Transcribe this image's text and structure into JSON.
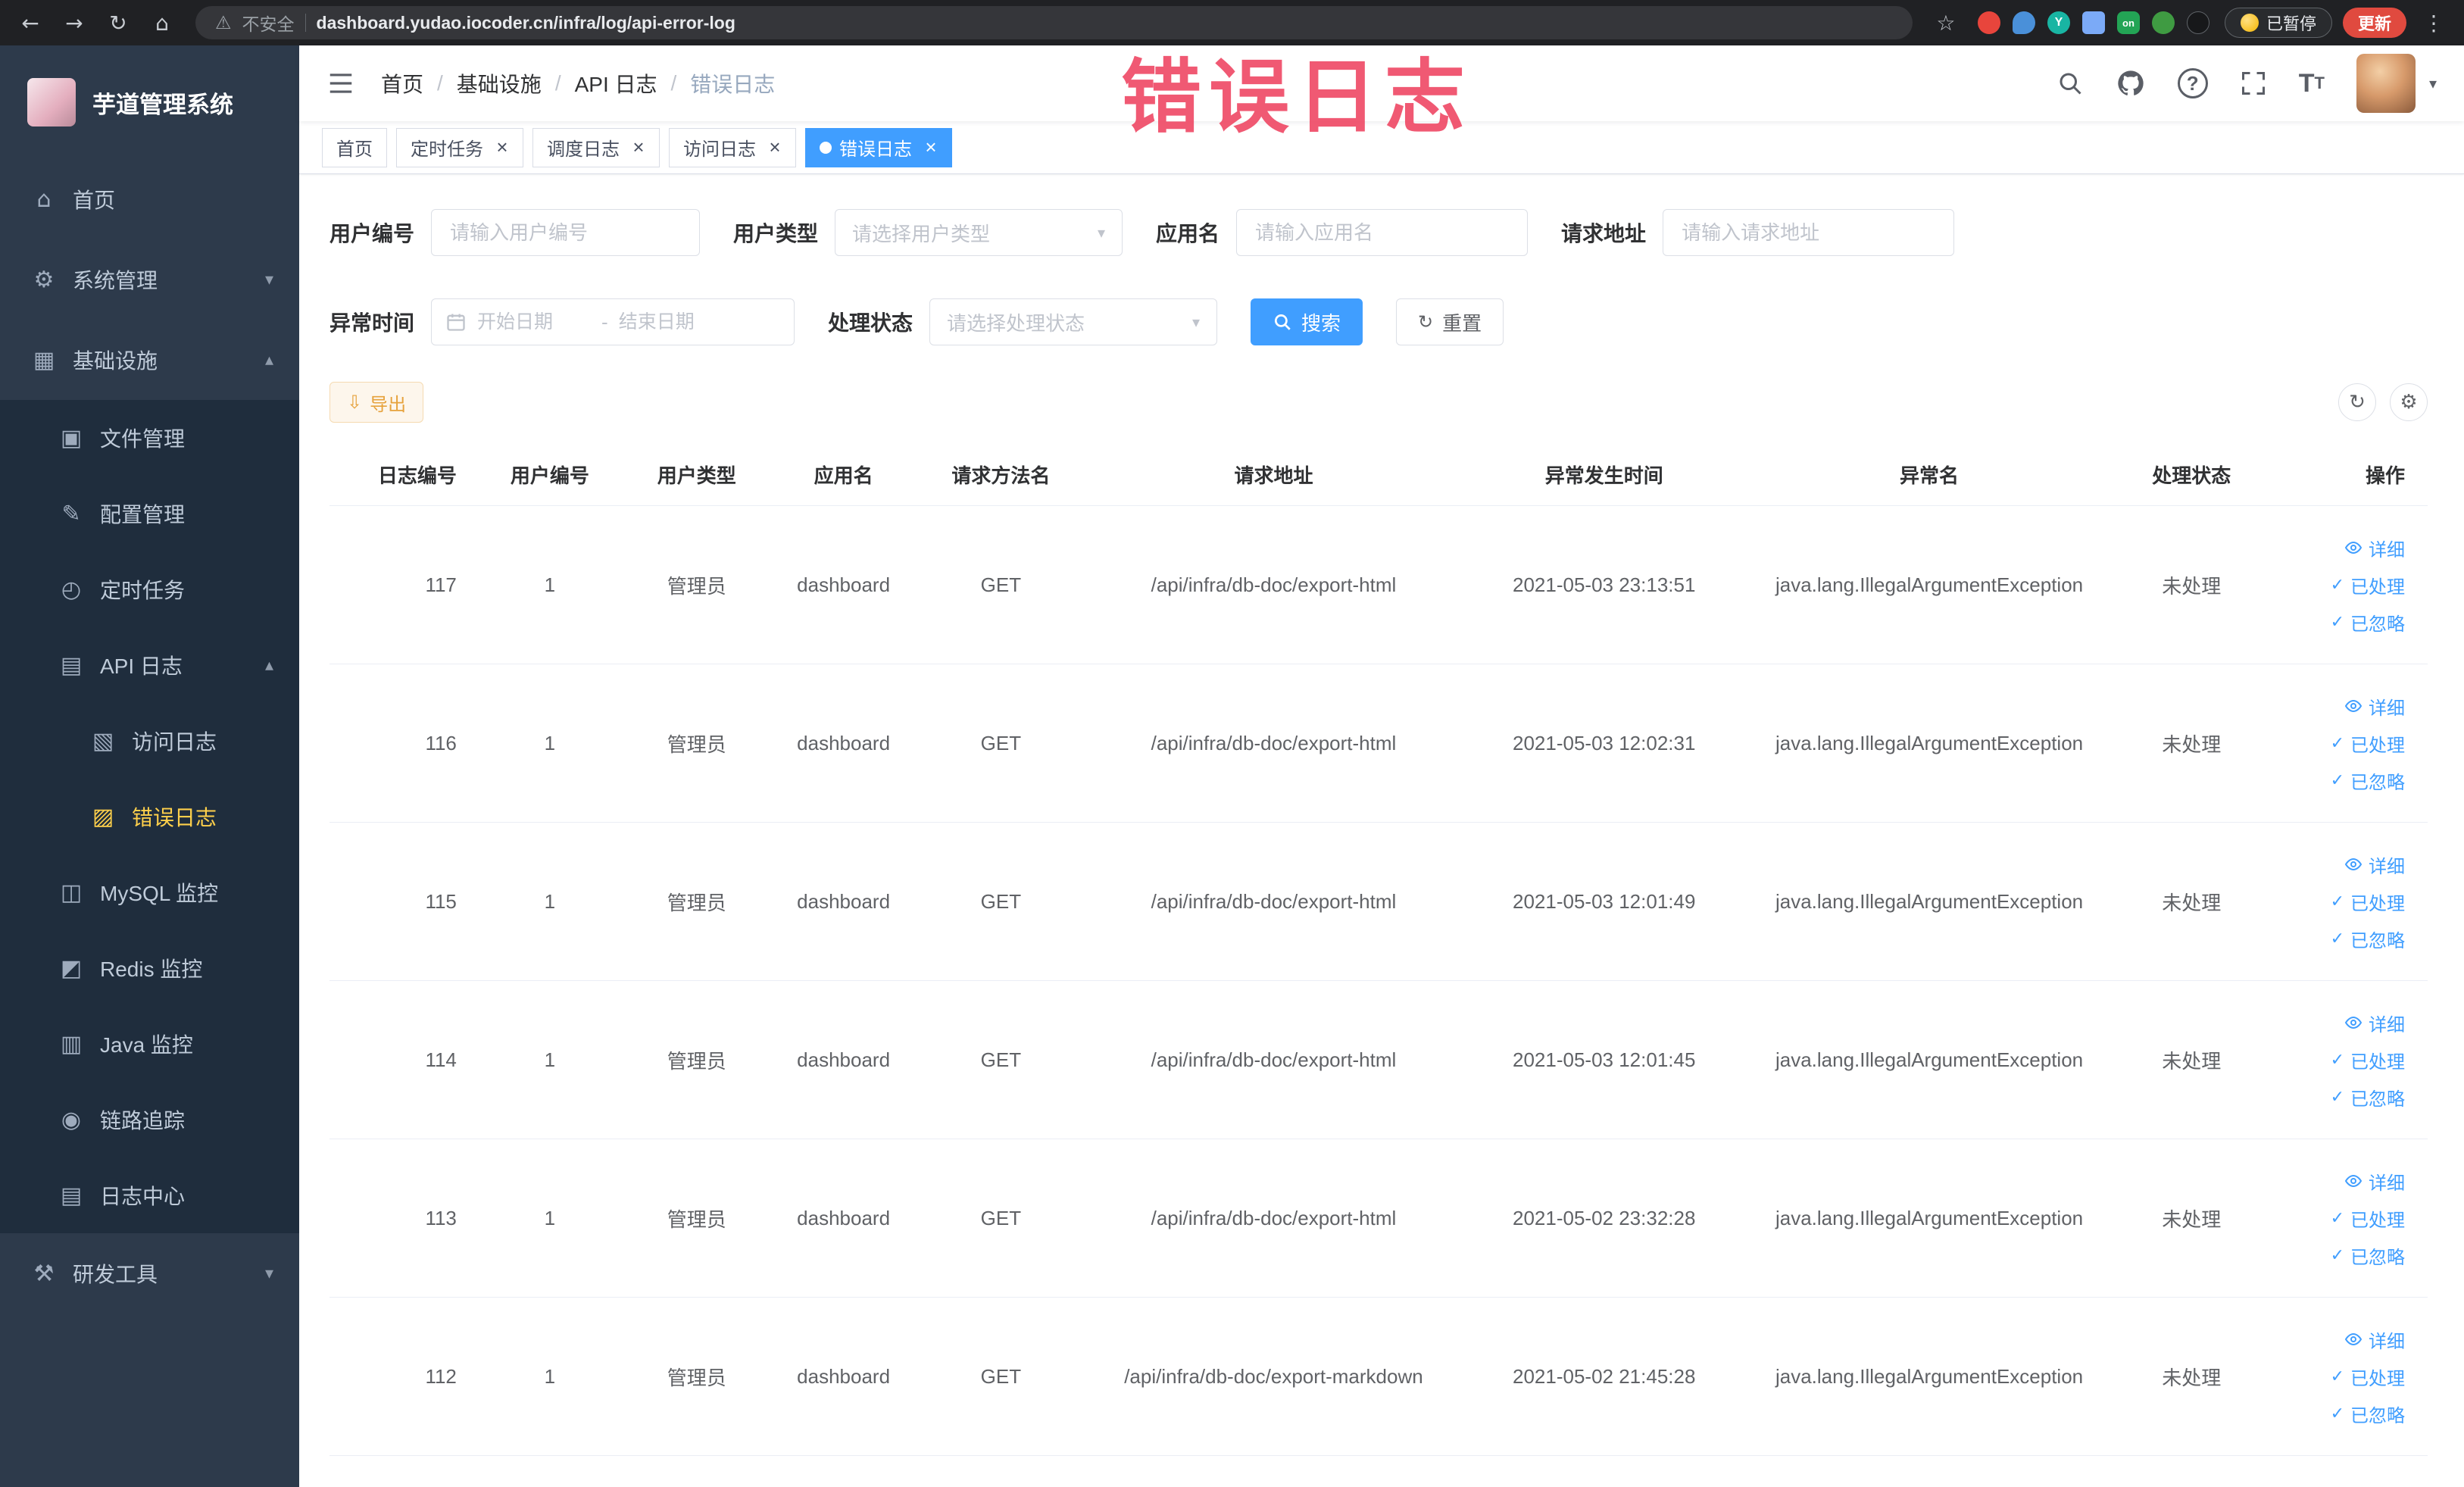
{
  "browser": {
    "security_label": "不安全",
    "url": "dashboard.yudao.iocoder.cn/infra/log/api-error-log",
    "on_badge": "on",
    "paused_button": "已暂停",
    "update_button": "更新"
  },
  "annotation": {
    "text": "错误日志"
  },
  "sidebar": {
    "logo_title": "芋道管理系统",
    "items": {
      "home": "首页",
      "system": "系统管理",
      "infra": "基础设施",
      "file": "文件管理",
      "config": "配置管理",
      "job": "定时任务",
      "api_log": "API 日志",
      "access_log": "访问日志",
      "error_log": "错误日志",
      "mysql": "MySQL 监控",
      "redis": "Redis 监控",
      "java": "Java 监控",
      "trace": "链路追踪",
      "log_center": "日志中心",
      "dev_tools": "研发工具"
    }
  },
  "header": {
    "breadcrumb": [
      "首页",
      "基础设施",
      "API 日志",
      "错误日志"
    ]
  },
  "tabs": [
    {
      "label": "首页"
    },
    {
      "label": "定时任务"
    },
    {
      "label": "调度日志"
    },
    {
      "label": "访问日志"
    },
    {
      "label": "错误日志"
    }
  ],
  "filters": {
    "user_id": {
      "label": "用户编号",
      "placeholder": "请输入用户编号"
    },
    "user_type": {
      "label": "用户类型",
      "placeholder": "请选择用户类型"
    },
    "app_name": {
      "label": "应用名",
      "placeholder": "请输入应用名"
    },
    "request_url": {
      "label": "请求地址",
      "placeholder": "请输入请求地址"
    },
    "exception_time": {
      "label": "异常时间",
      "start_placeholder": "开始日期",
      "separator": "-",
      "end_placeholder": "结束日期"
    },
    "process_status": {
      "label": "处理状态",
      "placeholder": "请选择处理状态"
    },
    "search_button": "搜索",
    "reset_button": "重置"
  },
  "toolbar": {
    "export_button": "导出"
  },
  "table": {
    "columns": [
      "日志编号",
      "用户编号",
      "用户类型",
      "应用名",
      "请求方法名",
      "请求地址",
      "异常发生时间",
      "异常名",
      "处理状态",
      "操作"
    ],
    "actions": {
      "detail": "详细",
      "processed": "已处理",
      "ignored": "已忽略"
    },
    "rows": [
      {
        "id": "117",
        "user_id": "1",
        "user_type": "管理员",
        "app_name": "dashboard",
        "method": "GET",
        "url": "/api/infra/db-doc/export-html",
        "time": "2021-05-03 23:13:51",
        "exception": "java.lang.IllegalArgumentException",
        "status": "未处理"
      },
      {
        "id": "116",
        "user_id": "1",
        "user_type": "管理员",
        "app_name": "dashboard",
        "method": "GET",
        "url": "/api/infra/db-doc/export-html",
        "time": "2021-05-03 12:02:31",
        "exception": "java.lang.IllegalArgumentException",
        "status": "未处理"
      },
      {
        "id": "115",
        "user_id": "1",
        "user_type": "管理员",
        "app_name": "dashboard",
        "method": "GET",
        "url": "/api/infra/db-doc/export-html",
        "time": "2021-05-03 12:01:49",
        "exception": "java.lang.IllegalArgumentException",
        "status": "未处理"
      },
      {
        "id": "114",
        "user_id": "1",
        "user_type": "管理员",
        "app_name": "dashboard",
        "method": "GET",
        "url": "/api/infra/db-doc/export-html",
        "time": "2021-05-03 12:01:45",
        "exception": "java.lang.IllegalArgumentException",
        "status": "未处理"
      },
      {
        "id": "113",
        "user_id": "1",
        "user_type": "管理员",
        "app_name": "dashboard",
        "method": "GET",
        "url": "/api/infra/db-doc/export-html",
        "time": "2021-05-02 23:32:28",
        "exception": "java.lang.IllegalArgumentException",
        "status": "未处理"
      },
      {
        "id": "112",
        "user_id": "1",
        "user_type": "管理员",
        "app_name": "dashboard",
        "method": "GET",
        "url": "/api/infra/db-doc/export-markdown",
        "time": "2021-05-02 21:45:28",
        "exception": "java.lang.IllegalArgumentException",
        "status": "未处理"
      }
    ]
  }
}
